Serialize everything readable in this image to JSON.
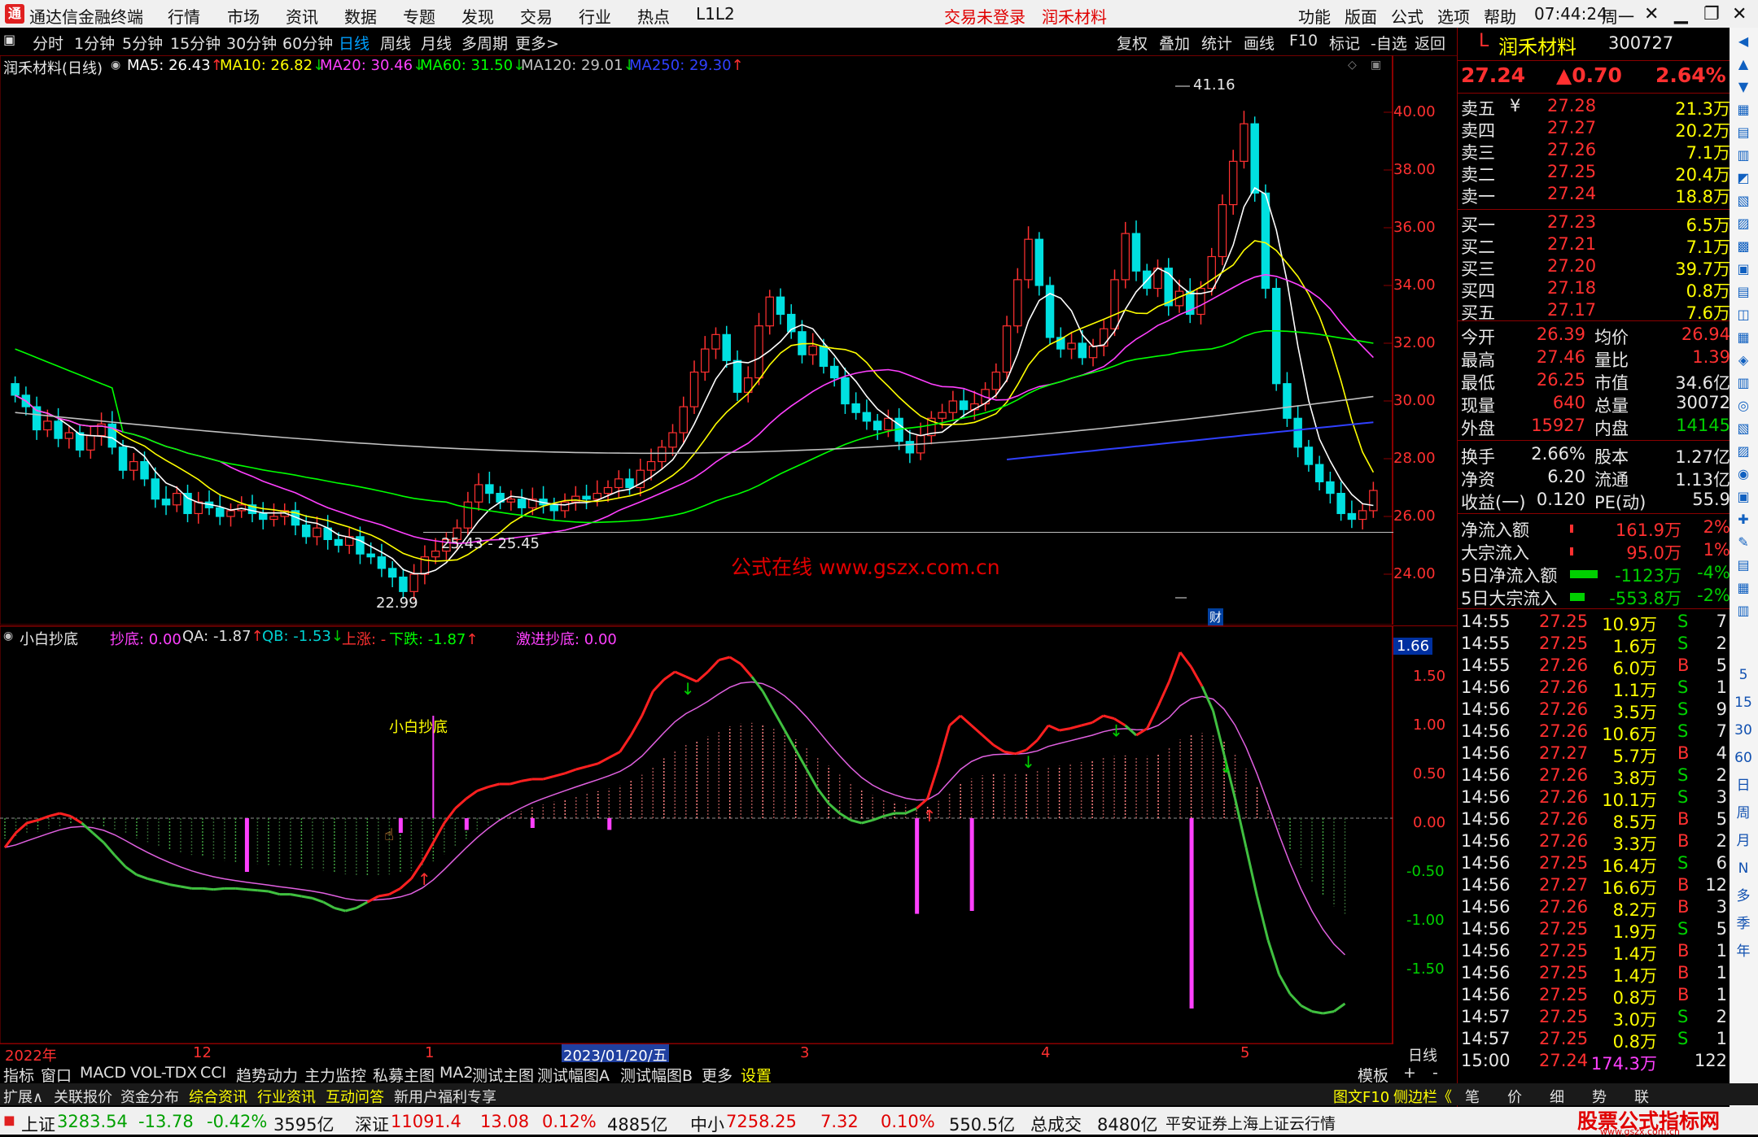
{
  "titlebar": {
    "app_name": "通达信金融终端",
    "menus": [
      "行情",
      "市场",
      "资讯",
      "数据",
      "专题",
      "发现",
      "交易",
      "行业",
      "热点",
      "L1L2"
    ],
    "trade_status": "交易未登录",
    "stock_name_link": "润禾材料",
    "right_menus": [
      "功能",
      "版面",
      "公式",
      "选项",
      "帮助"
    ],
    "time": "07:44:24",
    "weekday": "周一"
  },
  "periodbar": {
    "items": [
      "分时",
      "1分钟",
      "5分钟",
      "15分钟",
      "30分钟",
      "60分钟",
      "日线",
      "周线",
      "月线",
      "多周期",
      "更多>"
    ],
    "active": "日线",
    "right_items": [
      "复权",
      "叠加",
      "统计",
      "画线",
      "F10",
      "标记",
      "-自选",
      "返回"
    ]
  },
  "mainchart": {
    "title": "润禾材料(日线)",
    "ma": [
      {
        "label": "MA5: 26.43",
        "arrow": "↑",
        "color": "#ffffff"
      },
      {
        "label": "MA10: 26.82",
        "arrow": "↓",
        "color": "#ffff00"
      },
      {
        "label": "MA20: 30.46",
        "arrow": "↓",
        "color": "#ff40ff"
      },
      {
        "label": "MA60: 31.50",
        "arrow": "↓",
        "color": "#00ff00"
      },
      {
        "label": "MA120: 29.01",
        "arrow": "↓",
        "color": "#c0c0c0"
      },
      {
        "label": "MA250: 29.30",
        "arrow": "↑",
        "color": "#3040ff"
      }
    ],
    "high_label": "41.16",
    "low_label": "22.99",
    "range_label": "25.43 - 25.45",
    "watermark": "公式在线  www.gszx.com.cn",
    "cai_badge": "财",
    "y_ticks": [
      "40.00",
      "38.00",
      "36.00",
      "34.00",
      "32.00",
      "30.00",
      "28.00",
      "26.00",
      "24.00"
    ]
  },
  "subchart": {
    "title": "小白抄底",
    "legend": [
      {
        "label": "抄底: 0.00",
        "color": "#ff40ff"
      },
      {
        "label": "QA: -1.87",
        "arrow": "↑",
        "color": "#e0e0e0"
      },
      {
        "label": "QB: -1.53",
        "arrow": "↓",
        "color": "#00d0d0"
      },
      {
        "label": "上涨: -",
        "color": "#ff3030"
      },
      {
        "label": "下跌: -1.87",
        "arrow": "↑",
        "color": "#00ff00"
      },
      {
        "label": "激进抄底: 0.00",
        "color": "#ff40ff"
      }
    ],
    "annotation": "小白抄底",
    "current_value": "1.66",
    "y_ticks": [
      "1.50",
      "1.00",
      "0.50",
      "0.00",
      "-0.50",
      "-1.00",
      "-1.50"
    ]
  },
  "xaxis": {
    "labels": [
      "2022年",
      "12",
      "1",
      "2023/01/20/五",
      "3",
      "4",
      "5"
    ],
    "period": "日线"
  },
  "quote": {
    "code_prefix": "L",
    "name": "润禾材料",
    "code": "300727",
    "price": "27.24",
    "change": "▲0.70",
    "pct": "2.64%",
    "asks": [
      {
        "label": "卖五",
        "mark": "¥",
        "price": "27.28",
        "vol": "21.3万"
      },
      {
        "label": "卖四",
        "price": "27.27",
        "vol": "20.2万"
      },
      {
        "label": "卖三",
        "price": "27.26",
        "vol": "7.1万"
      },
      {
        "label": "卖二",
        "price": "27.25",
        "vol": "20.4万"
      },
      {
        "label": "卖一",
        "price": "27.24",
        "vol": "18.8万"
      }
    ],
    "bids": [
      {
        "label": "买一",
        "price": "27.23",
        "vol": "6.5万"
      },
      {
        "label": "买二",
        "price": "27.21",
        "vol": "7.1万"
      },
      {
        "label": "买三",
        "price": "27.20",
        "vol": "39.7万"
      },
      {
        "label": "买四",
        "price": "27.18",
        "vol": "0.8万"
      },
      {
        "label": "买五",
        "price": "27.17",
        "vol": "7.6万"
      }
    ],
    "stats": [
      {
        "l1": "今开",
        "v1": "26.39",
        "c1": "#ff3030",
        "l2": "均价",
        "v2": "26.94",
        "c2": "#ff3030"
      },
      {
        "l1": "最高",
        "v1": "27.46",
        "c1": "#ff3030",
        "l2": "量比",
        "v2": "1.39",
        "c2": "#ff3030"
      },
      {
        "l1": "最低",
        "v1": "26.25",
        "c1": "#ff3030",
        "l2": "市值",
        "v2": "34.6亿",
        "c2": "#e8e8e8"
      },
      {
        "l1": "现量",
        "v1": "640",
        "c1": "#ff3030",
        "l2": "总量",
        "v2": "30072",
        "c2": "#e8e8e8"
      },
      {
        "l1": "外盘",
        "v1": "15927",
        "c1": "#ff3030",
        "l2": "内盘",
        "v2": "14145",
        "c2": "#00d000"
      }
    ],
    "stats2": [
      {
        "l1": "换手",
        "v1": "2.66%",
        "l2": "股本",
        "v2": "1.27亿"
      },
      {
        "l1": "净资",
        "v1": "6.20",
        "l2": "流通",
        "v2": "1.13亿"
      },
      {
        "l1": "收益(一)",
        "v1": "0.120",
        "l2": "PE(动)",
        "v2": "55.9"
      }
    ],
    "flows": [
      {
        "label": "净流入额",
        "value": "161.9万",
        "pct": "2%",
        "dir": "up"
      },
      {
        "label": "大宗流入",
        "value": "95.0万",
        "pct": "1%",
        "dir": "up"
      },
      {
        "label": "5日净流入额",
        "value": "-1123万",
        "pct": "-4%",
        "dir": "down"
      },
      {
        "label": "5日大宗流入",
        "value": "-553.8万",
        "pct": "-2%",
        "dir": "down"
      }
    ],
    "ticks": [
      {
        "t": "14:55",
        "p": "27.25",
        "v": "10.9万",
        "s": "S",
        "n": "7"
      },
      {
        "t": "14:55",
        "p": "27.25",
        "v": "1.6万",
        "s": "S",
        "n": "2"
      },
      {
        "t": "14:55",
        "p": "27.26",
        "v": "6.0万",
        "s": "B",
        "n": "5"
      },
      {
        "t": "14:56",
        "p": "27.26",
        "v": "1.1万",
        "s": "S",
        "n": "1"
      },
      {
        "t": "14:56",
        "p": "27.26",
        "v": "3.5万",
        "s": "S",
        "n": "9"
      },
      {
        "t": "14:56",
        "p": "27.26",
        "v": "10.6万",
        "s": "S",
        "n": "7"
      },
      {
        "t": "14:56",
        "p": "27.27",
        "v": "5.7万",
        "s": "B",
        "n": "4"
      },
      {
        "t": "14:56",
        "p": "27.26",
        "v": "3.8万",
        "s": "S",
        "n": "2"
      },
      {
        "t": "14:56",
        "p": "27.26",
        "v": "10.1万",
        "s": "S",
        "n": "3"
      },
      {
        "t": "14:56",
        "p": "27.26",
        "v": "8.5万",
        "s": "B",
        "n": "5"
      },
      {
        "t": "14:56",
        "p": "27.26",
        "v": "3.3万",
        "s": "B",
        "n": "2"
      },
      {
        "t": "14:56",
        "p": "27.25",
        "v": "16.4万",
        "s": "S",
        "n": "6"
      },
      {
        "t": "14:56",
        "p": "27.27",
        "v": "16.6万",
        "s": "B",
        "n": "12"
      },
      {
        "t": "14:56",
        "p": "27.26",
        "v": "8.2万",
        "s": "B",
        "n": "3"
      },
      {
        "t": "14:56",
        "p": "27.25",
        "v": "1.9万",
        "s": "S",
        "n": "5"
      },
      {
        "t": "14:56",
        "p": "27.25",
        "v": "1.4万",
        "s": "B",
        "n": "1"
      },
      {
        "t": "14:56",
        "p": "27.25",
        "v": "1.4万",
        "s": "B",
        "n": "1"
      },
      {
        "t": "14:56",
        "p": "27.25",
        "v": "0.8万",
        "s": "B",
        "n": "1"
      },
      {
        "t": "14:57",
        "p": "27.25",
        "v": "3.0万",
        "s": "S",
        "n": "2"
      },
      {
        "t": "14:57",
        "p": "27.25",
        "v": "0.8万",
        "s": "S",
        "n": "1"
      },
      {
        "t": "15:00",
        "p": "27.24",
        "v": "174.3万",
        "s": "",
        "n": "122"
      }
    ]
  },
  "side_labels": [
    "5",
    "15",
    "30",
    "60",
    "日",
    "周",
    "月",
    "N",
    "多",
    "季",
    "年"
  ],
  "tabs": [
    "指标",
    "窗口",
    "MACD",
    "VOL-TDX",
    "CCI",
    "趋势动力",
    "主力监控",
    "私募主图",
    "MA2",
    "测试主图",
    "测试幅图A",
    "测试幅图B",
    "更多",
    "设置"
  ],
  "tabs_right": [
    "模板",
    "+",
    "-"
  ],
  "tabs2": [
    {
      "label": "扩展∧",
      "color": "#e0e0e0"
    },
    {
      "label": "关联报价",
      "color": "#e0e0e0"
    },
    {
      "label": "资金分布",
      "color": "#e0e0e0"
    },
    {
      "label": "综合资讯",
      "color": "#ffff00"
    },
    {
      "label": "行业资讯",
      "color": "#ffff00"
    },
    {
      "label": "互动问答",
      "color": "#ffff00"
    },
    {
      "label": "新用户福利专享",
      "color": "#e0e0e0"
    }
  ],
  "tabs2_right": [
    {
      "label": "图文F10",
      "color": "#ffff00"
    },
    {
      "label": "侧边栏《",
      "color": "#ffff00"
    },
    {
      "label": "笔",
      "color": "#e0e0e0"
    },
    {
      "label": "价",
      "color": "#e0e0e0"
    },
    {
      "label": "细",
      "color": "#e0e0e0"
    },
    {
      "label": "势",
      "color": "#e0e0e0"
    },
    {
      "label": "联",
      "color": "#e0e0e0"
    }
  ],
  "statusbar": {
    "items": [
      {
        "label": "上证",
        "value": "3283.54",
        "chg": "-13.78",
        "pct": "-0.42%",
        "amt": "3595亿",
        "dir": "down"
      },
      {
        "label": "深证",
        "value": "11091.4",
        "chg": "13.08",
        "pct": "0.12%",
        "amt": "4885亿",
        "dir": "up"
      },
      {
        "label": "中小",
        "value": "7258.25",
        "chg": "7.32",
        "pct": "0.10%",
        "amt": "550.5亿",
        "dir": "up"
      }
    ],
    "total_label": "总成交",
    "total_value": "8480亿",
    "broker": "平安证券上海上证云行情",
    "brand": "股票公式指标网",
    "brand_url": "www.gszx.com.cn"
  },
  "colors": {
    "up": "#ff3030",
    "down": "#00d000",
    "accent_red": "#e00000",
    "panel_border": "#8b0000"
  }
}
